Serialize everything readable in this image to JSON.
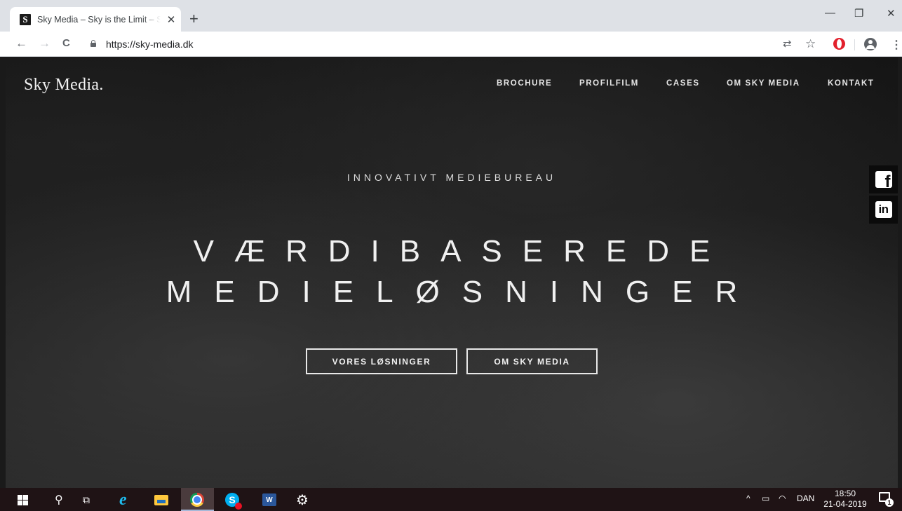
{
  "browser": {
    "tab_title": "Sky Media – Sky is the Limit – Sky Media",
    "favicon_letter": "S",
    "close_icon": "✕",
    "new_tab_icon": "+",
    "url": "https://sky-media.dk",
    "window_controls": {
      "minimize": "—",
      "restore": "❐",
      "close": "✕"
    },
    "nav_icons": {
      "back": "←",
      "forward": "→",
      "reload": "C",
      "translate": "⇄",
      "star": "☆",
      "menu": "⋮"
    }
  },
  "site": {
    "logo": "Sky Media.",
    "nav": [
      "BROCHURE",
      "PROFILFILM",
      "CASES",
      "OM SKY MEDIA",
      "KONTAKT"
    ],
    "subheading": "INNOVATIVT MEDIEBUREAU",
    "headline_line1": "VÆRDIBASEREDE",
    "headline_line2": "MEDIELØSNINGER",
    "buttons": [
      "VORES LØSNINGER",
      "OM SKY MEDIA"
    ],
    "social": {
      "facebook_glyph": "f",
      "linkedin_glyph": "in"
    }
  },
  "taskbar": {
    "search_icon": "⚲",
    "taskview_icon": "⧉",
    "ie_glyph": "e",
    "skype_glyph": "S",
    "word_glyph": "W",
    "settings_icon": "⚙",
    "tray_chevron": "^",
    "tray_battery": "▭",
    "tray_wifi": "◠",
    "language": "DAN",
    "time": "18:50",
    "date": "21-04-2019",
    "notification_count": "1"
  },
  "colors": {
    "chrome_tabstrip": "#dee1e6",
    "page_background": "#1a1a1a",
    "taskbar": "#1f1315"
  }
}
